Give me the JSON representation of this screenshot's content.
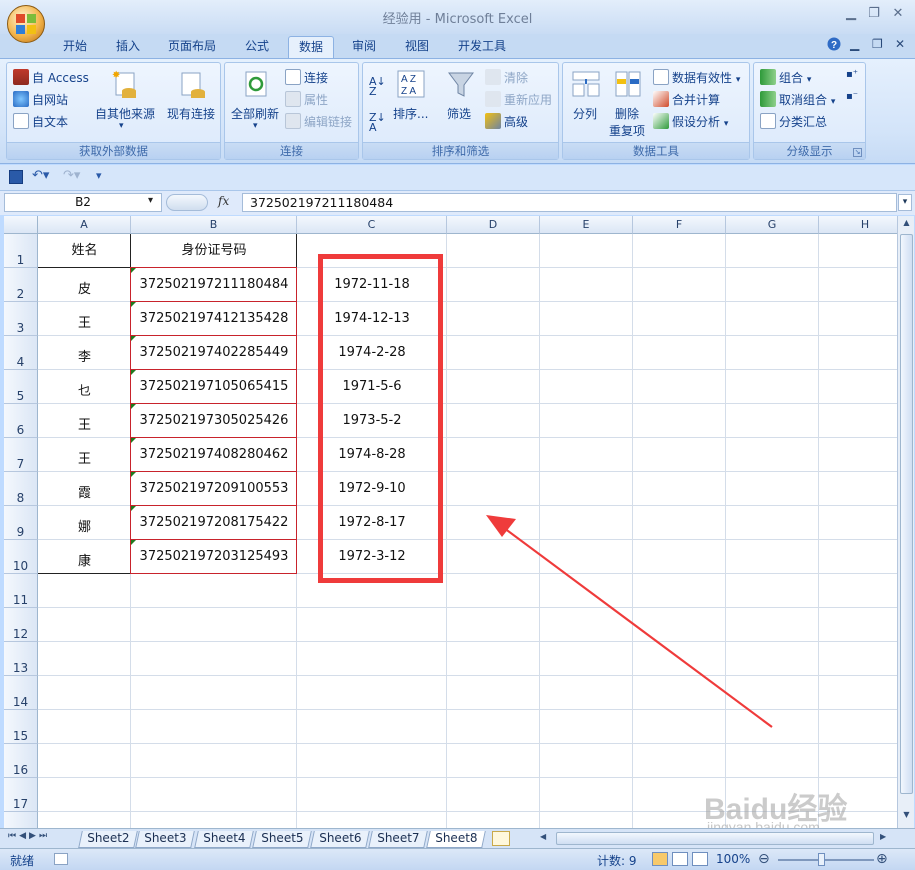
{
  "window": {
    "title": "经验用 - Microsoft Excel"
  },
  "tabs": [
    "开始",
    "插入",
    "页面布局",
    "公式",
    "数据",
    "审阅",
    "视图",
    "开发工具"
  ],
  "active_tab": "数据",
  "ribbon": {
    "groups": {
      "external": {
        "label": "获取外部数据",
        "access": "自 Access",
        "web": "自网站",
        "text": "自文本",
        "other": "自其他来源",
        "existing": "现有连接"
      },
      "connections": {
        "label": "连接",
        "refresh_all": "全部刷新",
        "connections": "连接",
        "properties": "属性",
        "edit_links": "编辑链接"
      },
      "sort_filter": {
        "label": "排序和筛选",
        "sort": "排序...",
        "filter": "筛选",
        "clear": "清除",
        "reapply": "重新应用",
        "advanced": "高级"
      },
      "data_tools": {
        "label": "数据工具",
        "text_to_columns": "分列",
        "remove_dup_1": "删除",
        "remove_dup_2": "重复项",
        "validation": "数据有效性",
        "consolidate": "合并计算",
        "what_if": "假设分析"
      },
      "outline": {
        "label": "分级显示",
        "group": "组合",
        "ungroup": "取消组合",
        "subtotal": "分类汇总"
      }
    }
  },
  "formula_bar": {
    "name_box": "B2",
    "fx": "fx",
    "formula": "372502197211180484"
  },
  "grid": {
    "columns": [
      "A",
      "B",
      "C",
      "D",
      "E",
      "F",
      "G",
      "H"
    ],
    "rows": [
      "1",
      "2",
      "3",
      "4",
      "5",
      "6",
      "7",
      "8",
      "9",
      "10",
      "11",
      "12",
      "13",
      "14",
      "15",
      "16",
      "17"
    ],
    "header_row": {
      "a": "姓名",
      "b": "身份证号码"
    },
    "data": [
      {
        "name": "皮",
        "id": "372502197211180484",
        "date": "1972-11-18"
      },
      {
        "name": "王",
        "id": "372502197412135428",
        "date": "1974-12-13"
      },
      {
        "name": "李",
        "id": "372502197402285449",
        "date": "1974-2-28"
      },
      {
        "name": "乜",
        "id": "372502197105065415",
        "date": "1971-5-6"
      },
      {
        "name": "王",
        "id": "372502197305025426",
        "date": "1973-5-2"
      },
      {
        "name": "王",
        "id": "372502197408280462",
        "date": "1974-8-28"
      },
      {
        "name": "霞",
        "id": "372502197209100553",
        "date": "1972-9-10"
      },
      {
        "name": "娜",
        "id": "372502197208175422",
        "date": "1972-8-17"
      },
      {
        "name": "康",
        "id": "372502197203125493",
        "date": "1972-3-12"
      }
    ]
  },
  "sheets": [
    "Sheet2",
    "Sheet3",
    "Sheet4",
    "Sheet5",
    "Sheet6",
    "Sheet7",
    "Sheet8"
  ],
  "active_sheet": "Sheet8",
  "status": {
    "ready": "就绪",
    "count": "计数: 9",
    "zoom": "100%"
  },
  "watermark": {
    "line1": "Baidu经验",
    "line2": "jingyan.baidu.com"
  },
  "colors": {
    "highlight": "#ef3b3b",
    "ribbon_text": "#15428b"
  }
}
